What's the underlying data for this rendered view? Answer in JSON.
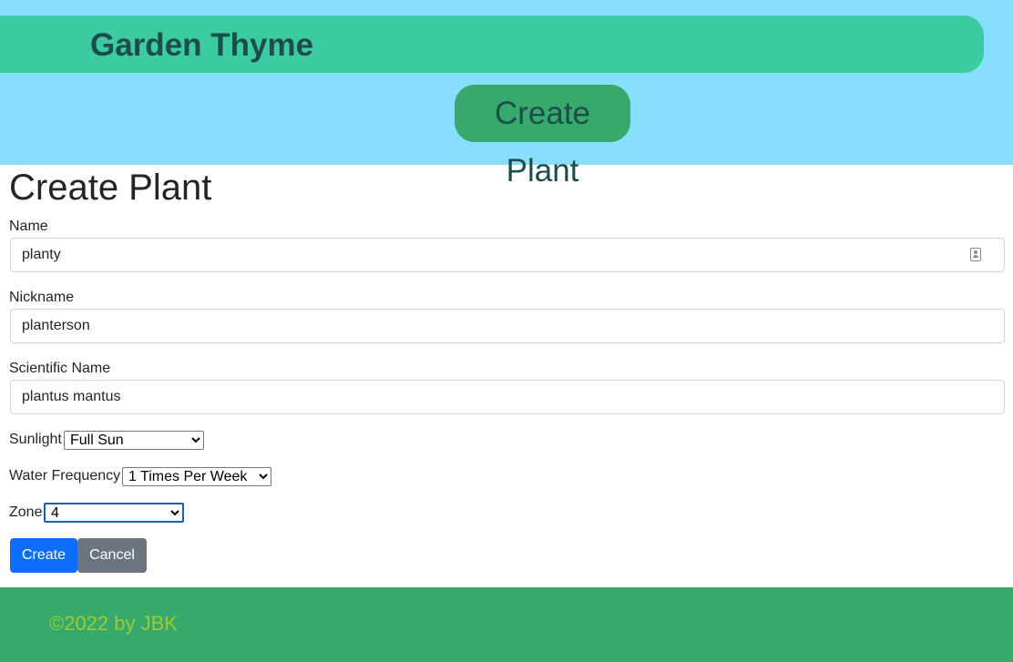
{
  "header": {
    "brand": "Garden Thyme",
    "nav_button": "Create Plant"
  },
  "page": {
    "title": "Create Plant"
  },
  "form": {
    "name": {
      "label": "Name",
      "value": "planty"
    },
    "nickname": {
      "label": "Nickname",
      "value": "planterson"
    },
    "scientific_name": {
      "label": "Scientific Name",
      "value": "plantus mantus"
    },
    "sunlight": {
      "label": "Sunlight",
      "selected": "Full Sun"
    },
    "water_frequency": {
      "label": "Water Frequency",
      "selected": "1 Times Per Week"
    },
    "zone": {
      "label": "Zone",
      "selected": "4"
    },
    "create_label": "Create",
    "cancel_label": "Cancel"
  },
  "footer": {
    "text": "©2022 by JBK"
  },
  "colors": {
    "header_bg": "#87dffd",
    "brand_bar": "#3ccba0",
    "nav_button": "#37a96c",
    "primary": "#0d6efd",
    "secondary": "#6c757d",
    "footer_bg": "#37a96c",
    "footer_text": "#9acd32"
  }
}
